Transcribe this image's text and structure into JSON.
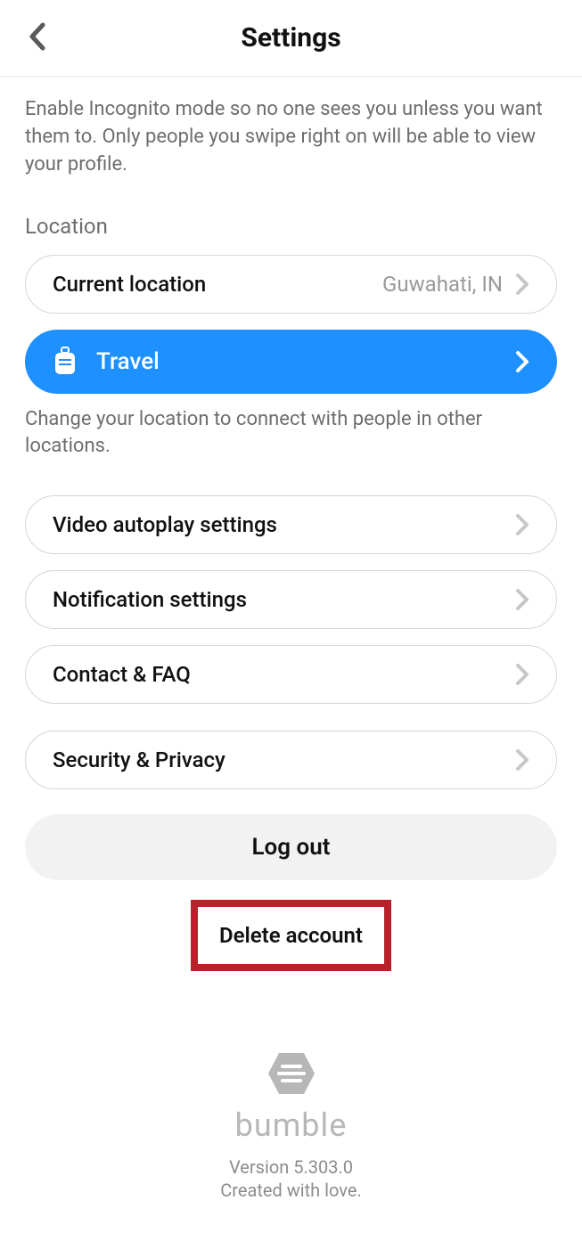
{
  "header": {
    "title": "Settings"
  },
  "incognito_desc": "Enable Incognito mode so no one sees you unless you want them to. Only people you swipe right on will be able to view your profile.",
  "location": {
    "section_label": "Location",
    "current_label": "Current location",
    "current_value": "Guwahati, IN",
    "travel_label": "Travel",
    "travel_desc": "Change your location to connect with people in other locations."
  },
  "rows": {
    "video_autoplay": "Video autoplay settings",
    "notifications": "Notification settings",
    "contact_faq": "Contact & FAQ",
    "security_privacy": "Security & Privacy"
  },
  "logout_label": "Log out",
  "delete_label": "Delete account",
  "footer": {
    "brand": "bumble",
    "version": "Version 5.303.0",
    "created": "Created with love."
  }
}
